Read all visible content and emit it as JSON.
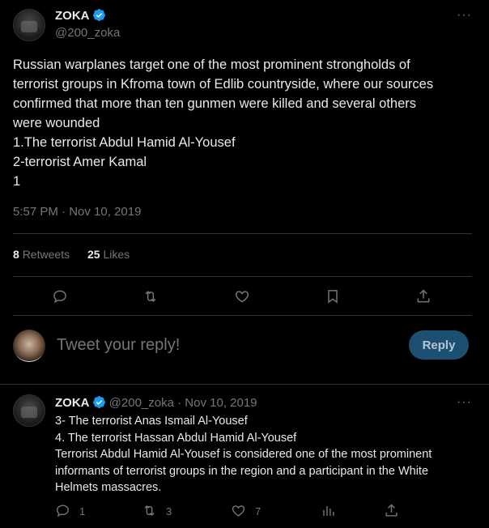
{
  "main_tweet": {
    "author_name": "ZOKA",
    "handle": "@200_zoka",
    "text": "Russian warplanes target one of the most prominent strongholds of\nterrorist groups in Kfroma town of Edlib countryside, where our sources\nconfirmed that more than ten gunmen were killed and several others\nwere wounded\n1.The terrorist Abdul Hamid Al-Yousef\n2-terrorist Amer Kamal\n1",
    "timestamp": "5:57 PM · Nov 10, 2019",
    "retweets_count": "8",
    "retweets_label": "Retweets",
    "likes_count": "25",
    "likes_label": "Likes",
    "more_label": "···"
  },
  "reply_composer": {
    "placeholder": "Tweet your reply!",
    "button_label": "Reply"
  },
  "reply_tweet": {
    "author_name": "ZOKA",
    "handle": "@200_zoka",
    "date": "· Nov 10, 2019",
    "text": "3- The terrorist Anas Ismail Al-Yousef\n4. The terrorist Hassan Abdul Hamid Al-Yousef\nTerrorist Abdul Hamid Al-Yousef is considered one of the most prominent\ninformants of terrorist groups in the region and a participant in the White\nHelmets massacres.",
    "replies_count": "1",
    "retweets_count": "3",
    "likes_count": "7",
    "more_label": "···"
  },
  "colors": {
    "background": "#000000",
    "text": "#e7e9ea",
    "muted": "#71767b",
    "divider": "#2f3336",
    "verified": "#1d9bf0",
    "reply_button": "#1d4f73"
  }
}
